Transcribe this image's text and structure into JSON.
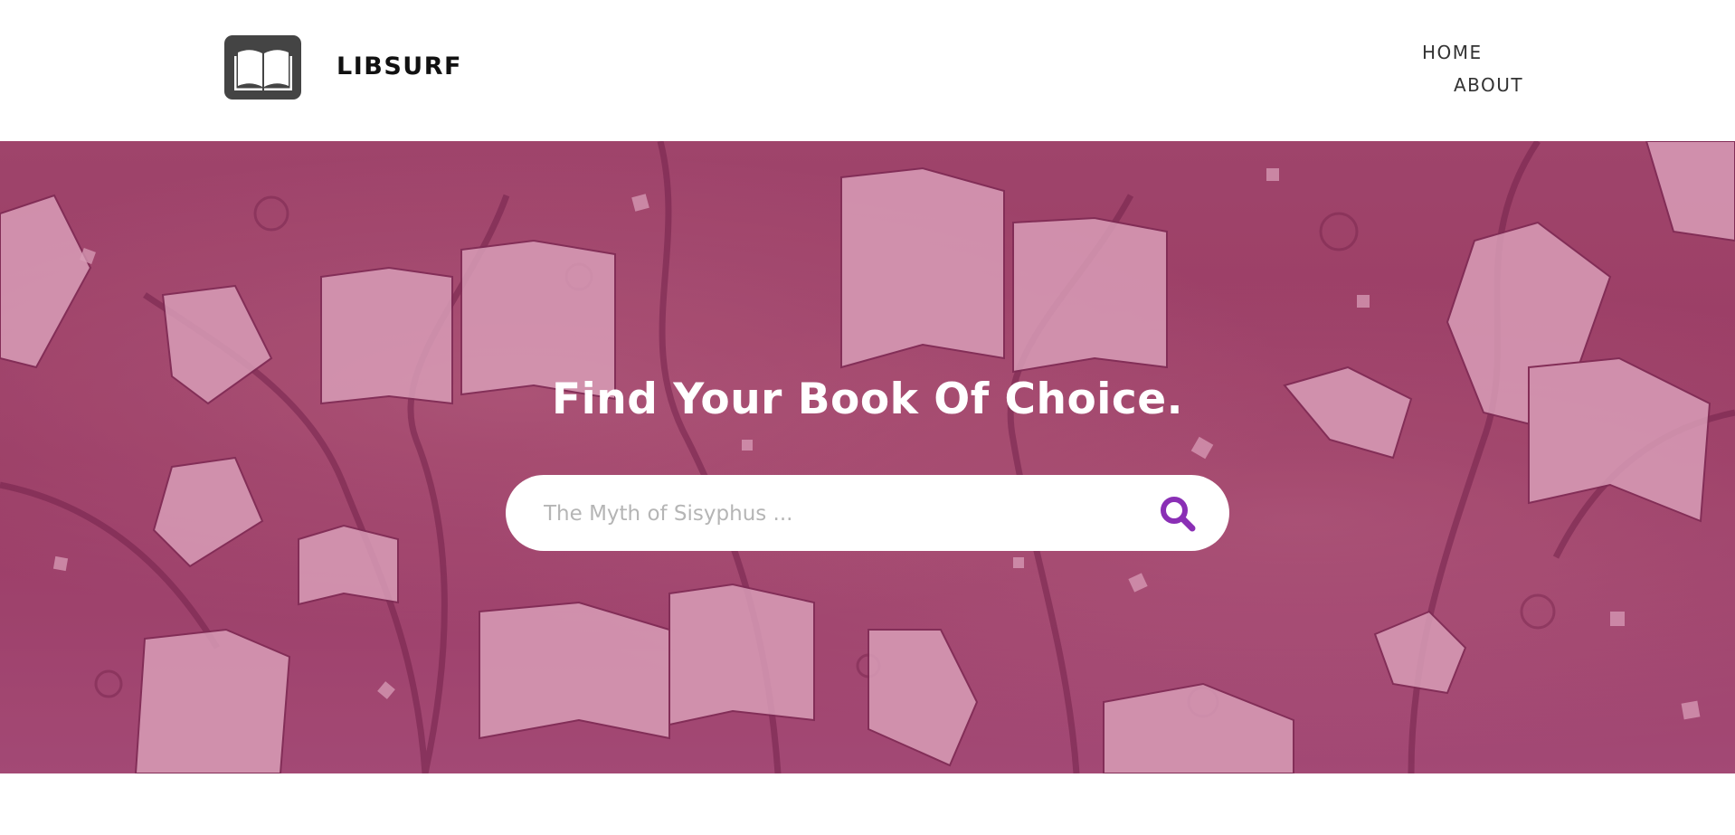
{
  "header": {
    "brand": "LIBSURF",
    "logo_icon": "open-book-icon",
    "nav": {
      "home": "HOME",
      "about": "ABOUT"
    }
  },
  "hero": {
    "title": "Find Your Book Of Choice.",
    "search": {
      "placeholder": "The Myth of Sisyphus ...",
      "value": "",
      "icon": "search-icon",
      "icon_color": "#8a2fb5"
    }
  },
  "colors": {
    "hero_tint": "#a3466d",
    "logo_bg": "#444444",
    "accent": "#8a2fb5"
  }
}
